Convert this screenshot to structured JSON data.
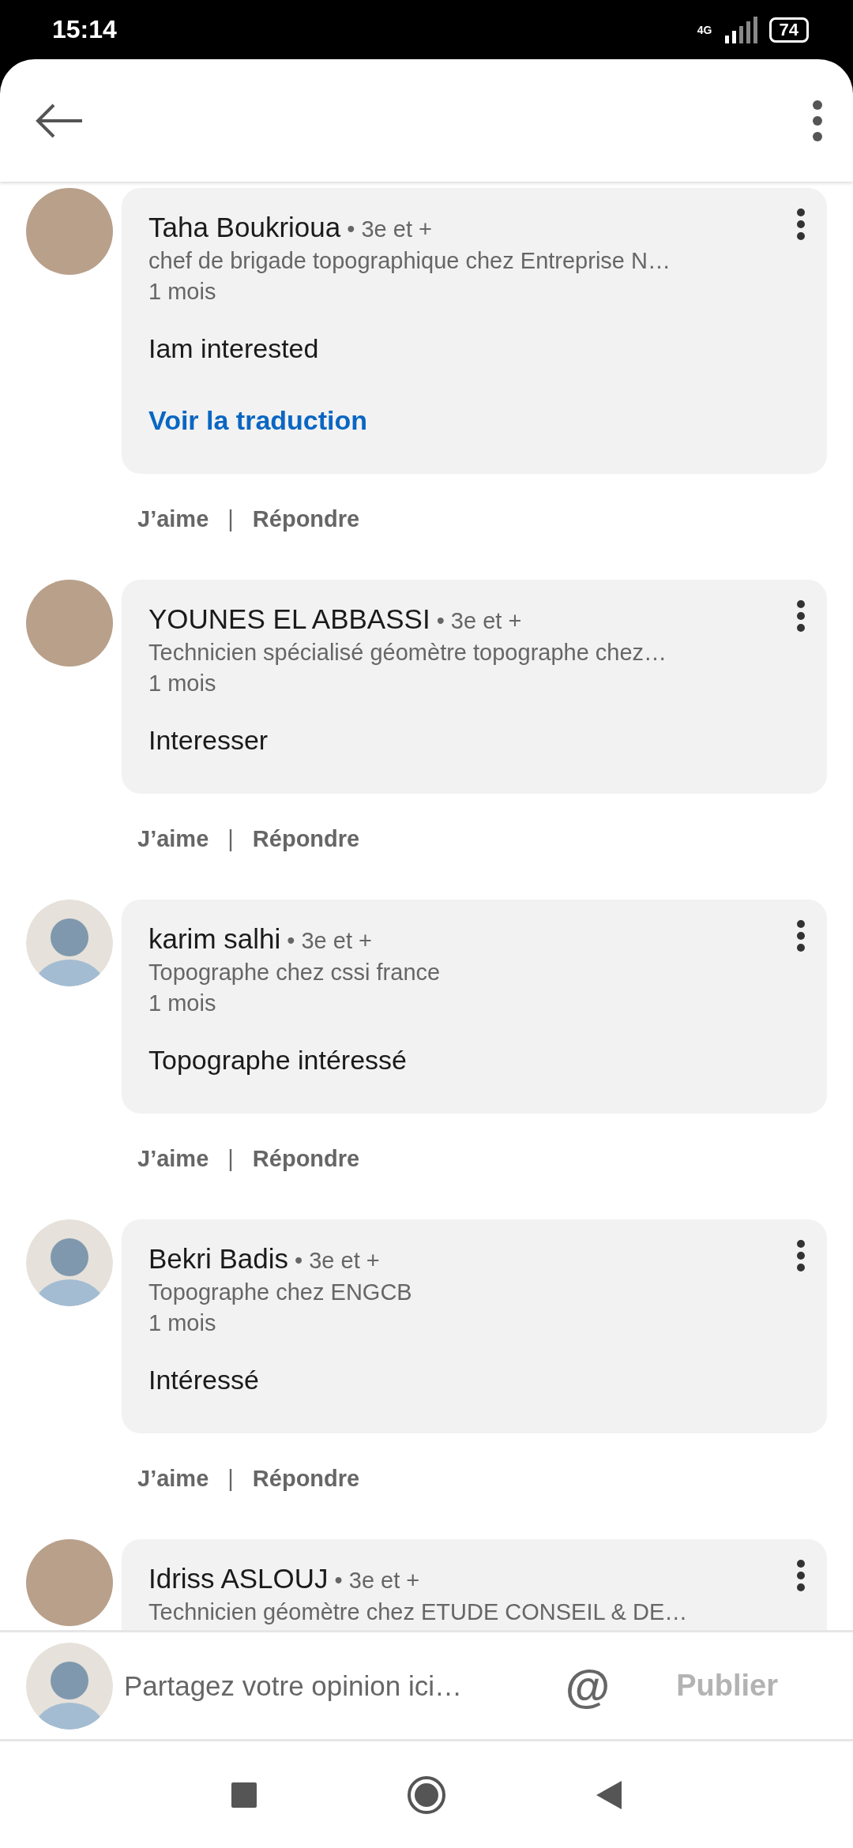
{
  "status_bar": {
    "time": "15:14",
    "network": "4G",
    "battery": "74"
  },
  "comments": [
    {
      "name": "Taha Boukrioua",
      "degree": "• 3e et +",
      "headline": "chef de brigade topographique chez Entreprise N…",
      "time": "1 mois",
      "text": "Iam interested",
      "translation_link": "Voir la traduction",
      "avatar": {
        "kind": "photo"
      },
      "like": "J’aime",
      "separator": "|",
      "reply": "Répondre"
    },
    {
      "name": "YOUNES EL ABBASSI",
      "degree": "• 3e et +",
      "headline": "Technicien spécialisé géomètre topographe chez…",
      "time": "1 mois",
      "text": "Interesser",
      "avatar": {
        "kind": "photo"
      },
      "like": "J’aime",
      "separator": "|",
      "reply": "Répondre"
    },
    {
      "name": "karim salhi",
      "degree": "• 3e et +",
      "headline": "Topographe chez cssi france",
      "time": "1 mois",
      "text": "Topographe intéressé",
      "avatar": {
        "kind": "default"
      },
      "like": "J’aime",
      "separator": "|",
      "reply": "Répondre"
    },
    {
      "name": "Bekri Badis",
      "degree": "• 3e et +",
      "headline": "Topographe chez ENGCB",
      "time": "1 mois",
      "text": "Intéressé",
      "avatar": {
        "kind": "default"
      },
      "like": "J’aime",
      "separator": "|",
      "reply": "Répondre"
    },
    {
      "name": "Idriss ASLOUJ",
      "degree": "• 3e et +",
      "headline": "Technicien géomètre chez ETUDE CONSEIL & DE…",
      "avatar": {
        "kind": "photo"
      }
    }
  ],
  "composer": {
    "placeholder": "Partagez votre opinion ici…",
    "mention": "@",
    "publish": {
      "label": "Publier",
      "disabled": true
    }
  }
}
